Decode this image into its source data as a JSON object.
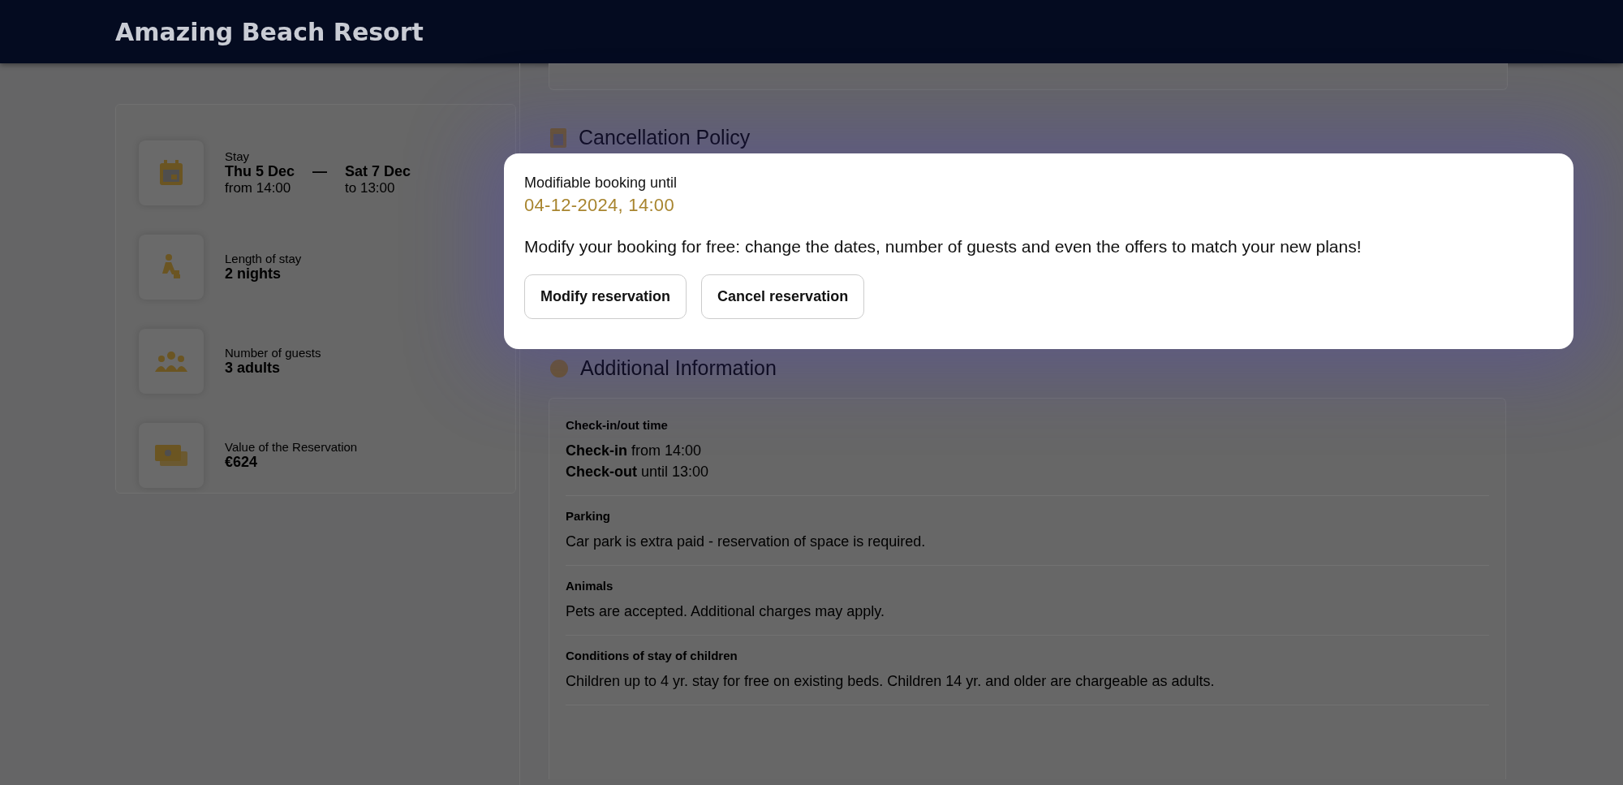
{
  "header": {
    "title": "Amazing Beach Resort"
  },
  "stay_summary": [
    {
      "kind": "dates",
      "label": "Stay",
      "from_date": "Thu 5 Dec",
      "from_time": "from 14:00",
      "separator": "—",
      "to_date": "Sat 7 Dec",
      "to_time": "to 13:00"
    },
    {
      "kind": "simple",
      "label": "Length of stay",
      "value": "2 nights"
    },
    {
      "kind": "simple",
      "label": "Number of guests",
      "value": "3 adults"
    },
    {
      "kind": "simple",
      "label": "Value of the Reservation",
      "value": "€624"
    }
  ],
  "cancellation_policy": {
    "heading": "Cancellation Policy"
  },
  "additional_information": {
    "heading": "Additional Information",
    "items": [
      {
        "title": "Check-in/out time",
        "lines": [
          "**Check-in** from 14:00",
          "**Check-out** until 13:00"
        ]
      },
      {
        "title": "Parking",
        "lines": [
          "Car park is extra paid - reservation of space is required."
        ]
      },
      {
        "title": "Animals",
        "lines": [
          "Pets are accepted. Additional charges may apply."
        ]
      },
      {
        "title": "Conditions of stay of children",
        "lines": [
          "Children up to 4 yr. stay for free on existing beds. Children 14 yr. and older are chargeable as adults."
        ]
      }
    ]
  },
  "modal": {
    "label": "Modifiable booking until",
    "deadline": "04-12-2024, 14:00",
    "message": "Modify your booking for free: change the dates, number of guests and even the offers to match your new plans!",
    "buttons": [
      "Modify reservation",
      "Cancel reservation"
    ]
  }
}
